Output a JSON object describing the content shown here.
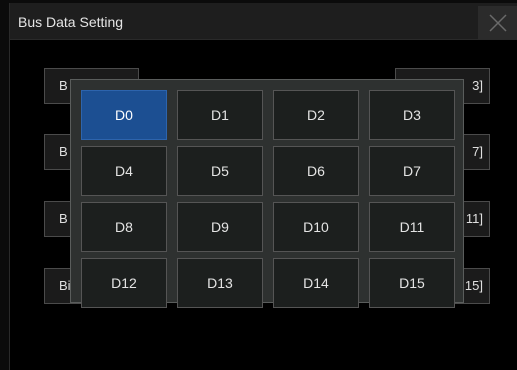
{
  "dialog": {
    "title": "Bus Data Setting"
  },
  "background_buttons": {
    "left": [
      "B",
      "B",
      "B",
      "Bit"
    ],
    "right": [
      "3]",
      "7]",
      "11]",
      "15]"
    ]
  },
  "popup": {
    "items": [
      "D0",
      "D1",
      "D2",
      "D3",
      "D4",
      "D5",
      "D6",
      "D7",
      "D8",
      "D9",
      "D10",
      "D11",
      "D12",
      "D13",
      "D14",
      "D15"
    ],
    "selected": "D0"
  },
  "colors": {
    "selected": "#1c4f92",
    "popup_bg": "#2e3130",
    "button_bg": "#1c1f1e"
  }
}
